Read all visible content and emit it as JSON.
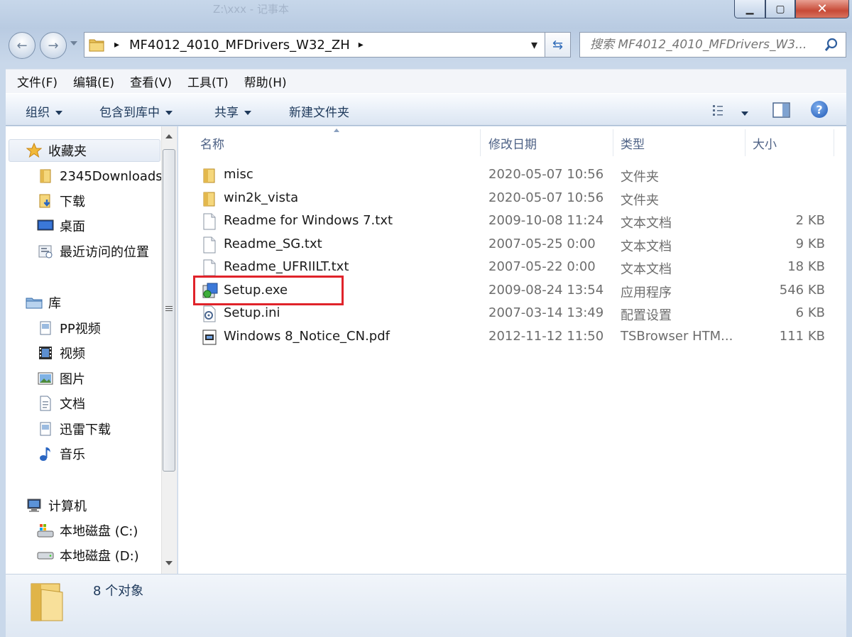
{
  "window": {
    "title": "Z:\\xxx - 记事本",
    "controls": {
      "minimize": "▁",
      "maximize": "▢",
      "close": "✕"
    }
  },
  "address": {
    "crumb_separator": "▸",
    "path": "MF4012_4010_MFDrivers_W32_ZH",
    "trailing_arrow": "▸",
    "dropdown": "▾",
    "refresh_icon": "⇆"
  },
  "search": {
    "placeholder": "搜索 MF4012_4010_MFDrivers_W3..."
  },
  "menu": [
    "文件(F)",
    "编辑(E)",
    "查看(V)",
    "工具(T)",
    "帮助(H)"
  ],
  "toolbar": {
    "organize": "组织",
    "include_library": "包含到库中",
    "share": "共享",
    "new_folder": "新建文件夹",
    "help": "?"
  },
  "nav": {
    "favorites": "收藏夹",
    "favorites_items": [
      "2345Downloads",
      "下载",
      "桌面",
      "最近访问的位置"
    ],
    "libraries": "库",
    "library_items": [
      "PP视频",
      "视频",
      "图片",
      "文档",
      "迅雷下载",
      "音乐"
    ],
    "computer": "计算机",
    "computer_items": [
      "本地磁盘 (C:)",
      "本地磁盘 (D:)"
    ]
  },
  "columns": {
    "name": "名称",
    "date": "修改日期",
    "type": "类型",
    "size": "大小"
  },
  "files": [
    {
      "name": "misc",
      "date": "2020-05-07 10:56",
      "type": "文件夹",
      "size": "",
      "icon": "folder-icon"
    },
    {
      "name": "win2k_vista",
      "date": "2020-05-07 10:56",
      "type": "文件夹",
      "size": "",
      "icon": "folder-icon"
    },
    {
      "name": "Readme for Windows 7.txt",
      "date": "2009-10-08 11:24",
      "type": "文本文档",
      "size": "2 KB",
      "icon": "text-file-icon"
    },
    {
      "name": "Readme_SG.txt",
      "date": "2007-05-25 0:00",
      "type": "文本文档",
      "size": "9 KB",
      "icon": "text-file-icon"
    },
    {
      "name": "Readme_UFRIILT.txt",
      "date": "2007-05-22 0:00",
      "type": "文本文档",
      "size": "18 KB",
      "icon": "text-file-icon"
    },
    {
      "name": "Setup.exe",
      "date": "2009-08-24 13:54",
      "type": "应用程序",
      "size": "546 KB",
      "icon": "setup-exe-icon"
    },
    {
      "name": "Setup.ini",
      "date": "2007-03-14 13:49",
      "type": "配置设置",
      "size": "6 KB",
      "icon": "config-file-icon"
    },
    {
      "name": "Windows 8_Notice_CN.pdf",
      "date": "2012-11-12 11:50",
      "type": "TSBrowser HTM...",
      "size": "111 KB",
      "icon": "pdf-file-icon"
    }
  ],
  "status": {
    "count": "8 个对象"
  },
  "colors": {
    "highlight": "#e0232a",
    "accent": "#2f6bb8",
    "column_header": "#4d6185"
  }
}
